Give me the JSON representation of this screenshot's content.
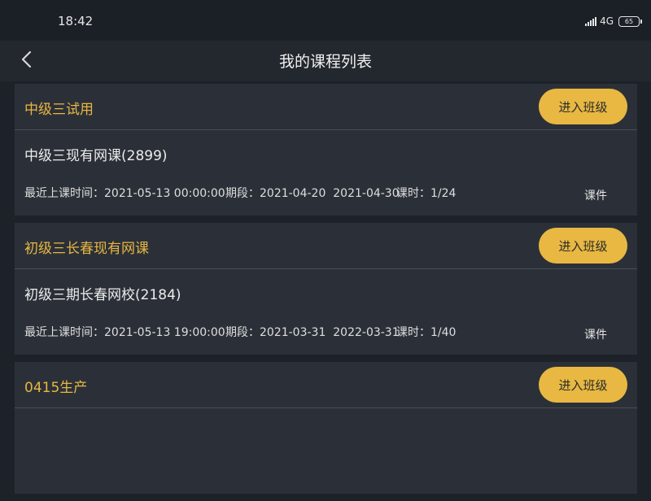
{
  "status_bar": {
    "time": "18:42",
    "network": "4G",
    "network_sub": "ᵢₗ",
    "battery": "65"
  },
  "header": {
    "title": "我的课程列表",
    "back_icon": "chevron-left-icon"
  },
  "courses": [
    {
      "class_name": "中级三试用",
      "enter_label": "进入班级",
      "course_name": "中级三现有网课(2899)",
      "lesson_time": "最近上课时间：2021-05-13 00:00:00",
      "period": "期段：2021-04-20  2021-04-30",
      "hours": "课时：1/24",
      "courseware_label": "课件"
    },
    {
      "class_name": "初级三长春现有网课",
      "enter_label": "进入班级",
      "course_name": "初级三期长春网校(2184)",
      "lesson_time": "最近上课时间：2021-05-13 19:00:00",
      "period": "期段：2021-03-31  2022-03-31",
      "hours": "课时：1/40",
      "courseware_label": "课件"
    },
    {
      "class_name": "0415生产",
      "enter_label": "进入班级"
    }
  ],
  "colors": {
    "accent": "#e8b842",
    "background": "#1d2128",
    "card": "#2b3038"
  }
}
